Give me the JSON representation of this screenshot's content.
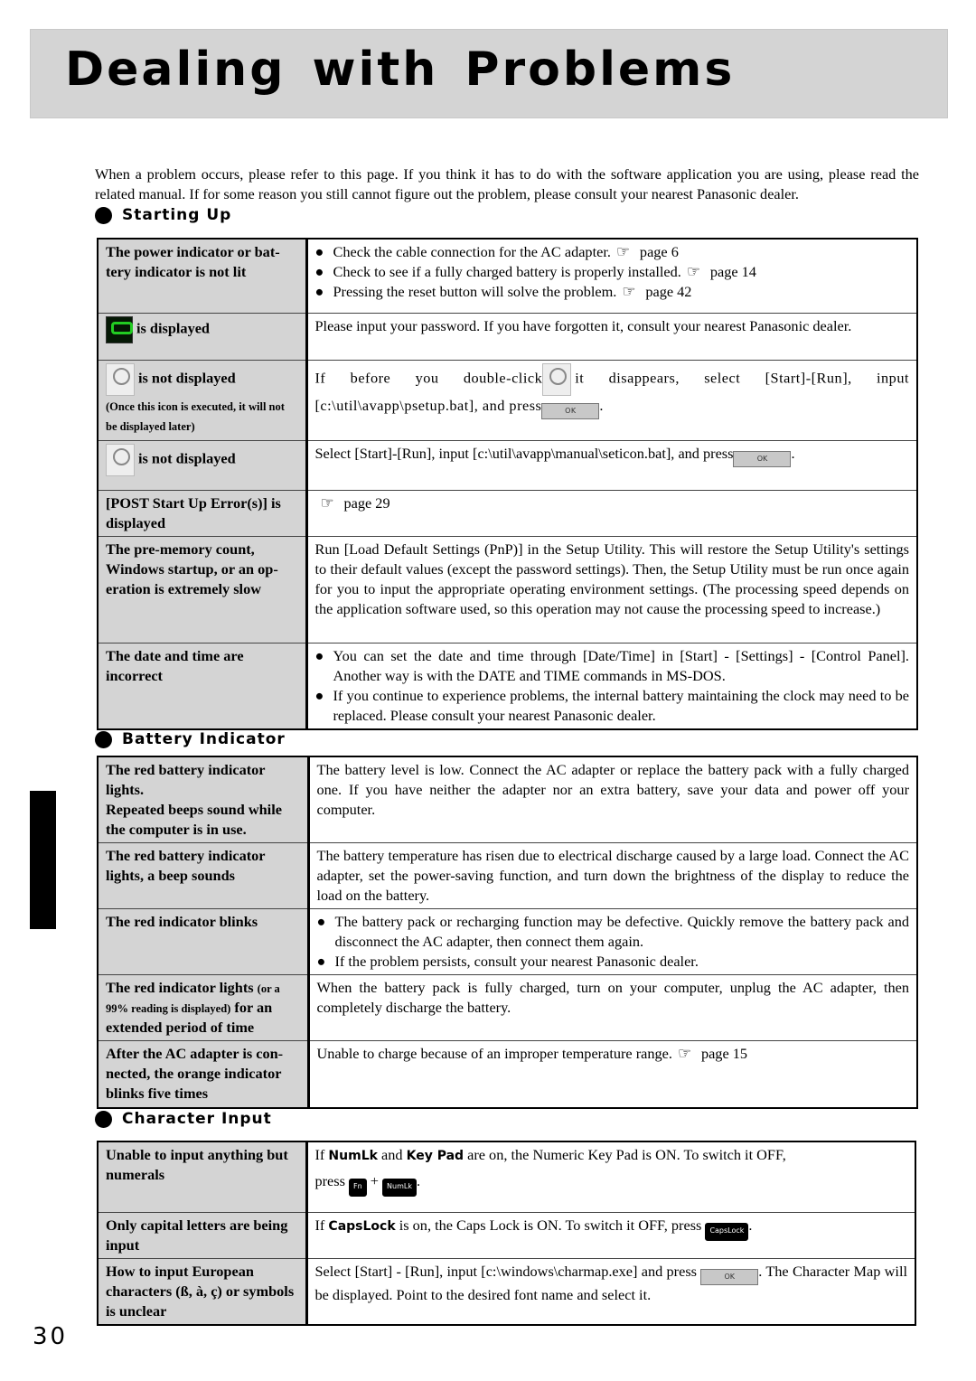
{
  "title": "Dealing with Problems",
  "intro": "When a problem occurs, please refer to this page.  If you think it has to do with the software application you are using, please read the related manual.  If for some reason you still cannot figure out the problem, please consult your nearest Panasonic dealer.",
  "page_number": "30",
  "sections": [
    {
      "heading": "Starting Up",
      "rows": [
        {
          "problem": [
            [
              {
                "t": "The power indicator or bat-tery indicator is not lit"
              }
            ]
          ],
          "solution": {
            "bullets": [
              [
                {
                  "t": "Check the cable connection for the AC adapter."
                },
                {
                  "icon": "pointer"
                },
                {
                  "t": "page 6"
                }
              ],
              [
                {
                  "t": "Check to see if a fully charged battery is properly installed."
                },
                {
                  "icon": "pointer"
                },
                {
                  "t": "page 14"
                }
              ],
              [
                {
                  "t": "Pressing the reset button will solve the problem."
                },
                {
                  "icon": "pointer"
                },
                {
                  "t": "page 42"
                }
              ]
            ]
          }
        },
        {
          "problem": [
            [
              {
                "icon": "password-key"
              },
              {
                "t": "is displayed"
              }
            ]
          ],
          "solution": {
            "paras": [
              [
                {
                  "t": "Please input your password.  If you have forgotten it, consult your nearest Panasonic dealer."
                }
              ]
            ]
          }
        },
        {
          "problem": [
            [
              {
                "icon": "panasonic-setup"
              },
              {
                "t": "is not displayed"
              }
            ],
            [
              {
                "t": "(Once this icon is executed,  it will not be displayed later)",
                "small": true
              }
            ]
          ],
          "solution": {
            "paras": [
              [
                {
                  "t": "If before you double-click"
                },
                {
                  "icon": "panasonic-setup"
                },
                {
                  "t": "it disappears, select [Start]-[Run], input [c:\\util\\avapp\\psetup.bat], and press"
                },
                {
                  "icon": "ok"
                },
                {
                  "t": "."
                }
              ]
            ],
            "spaced": true
          }
        },
        {
          "problem": [
            [
              {
                "icon": "quick-guide"
              },
              {
                "t": "is not displayed"
              }
            ]
          ],
          "solution": {
            "paras": [
              [
                {
                  "t": "Select [Start]-[Run], input [c:\\util\\avapp\\manual\\seticon.bat], and press"
                },
                {
                  "icon": "ok"
                },
                {
                  "t": "."
                }
              ]
            ]
          }
        },
        {
          "problem": [
            [
              {
                "t": "[POST Start Up Error(s)] is displayed"
              }
            ]
          ],
          "solution": {
            "paras": [
              [
                {
                  "icon": "pointer"
                },
                {
                  "t": "page 29"
                }
              ]
            ]
          }
        },
        {
          "problem": [
            [
              {
                "t": "The pre-memory count, Windows startup, or an op-eration is extremely slow"
              }
            ]
          ],
          "solution": {
            "paras": [
              [
                {
                  "t": "Run [Load Default Settings (PnP)] in the Setup Utility. This will restore the Setup Utility's settings to their default values (except the password settings). Then, the Setup Utility must be run once again for you to input the appropriate operating environment settings.  (The processing speed depends on the application software used, so this operation may not cause the processing speed to increase.)"
                }
              ]
            ]
          }
        },
        {
          "problem": [
            [
              {
                "t": "The date and time are incorrect"
              }
            ]
          ],
          "solution": {
            "bullets": [
              [
                {
                  "t": "You can set the date and time through [Date/Time] in [Start] - [Settings] - [Control Panel]. Another way is with the DATE and TIME commands in MS-DOS."
                }
              ],
              [
                {
                  "t": "If you continue to experience problems, the internal battery maintaining the clock may need to be replaced.  Please consult your nearest Panasonic dealer."
                }
              ]
            ]
          }
        }
      ]
    },
    {
      "heading": "Battery Indicator",
      "rows": [
        {
          "problem": [
            [
              {
                "t": "The red battery indicator lights."
              }
            ],
            [
              {
                "t": "Repeated beeps sound while the computer is in use."
              }
            ]
          ],
          "solution": {
            "paras": [
              [
                {
                  "t": "The battery level is low. Connect the AC adapter or replace the battery pack with a fully charged one. If you have neither the adapter nor an extra battery, save your data and power off your computer."
                }
              ]
            ]
          }
        },
        {
          "problem": [
            [
              {
                "t": "The red battery indicator lights, a beep sounds"
              }
            ]
          ],
          "solution": {
            "paras": [
              [
                {
                  "t": "The battery temperature has risen due to electrical discharge caused by a large load. Connect the AC adapter, set the power-saving function, and turn down the brightness of the display to reduce the load on the battery."
                }
              ]
            ]
          }
        },
        {
          "problem": [
            [
              {
                "t": "The red indicator blinks"
              }
            ]
          ],
          "solution": {
            "bullets": [
              [
                {
                  "t": "The battery pack or recharging function may be defective.  Quickly remove the battery pack and disconnect the AC adapter, then connect them again."
                }
              ],
              [
                {
                  "t": "If the problem persists, consult your nearest Panasonic dealer."
                }
              ]
            ]
          }
        },
        {
          "problem": [
            [
              {
                "t": "The red indicator lights "
              },
              {
                "t": "(or a 99% reading is displayed)",
                "small": true
              },
              {
                "t": " for an extended period of time"
              }
            ]
          ],
          "solution": {
            "paras": [
              [
                {
                  "t": "When the battery pack is fully charged, turn on your computer, unplug the AC adapter, then completely discharge the battery."
                }
              ]
            ]
          }
        },
        {
          "problem": [
            [
              {
                "t": "After the AC adapter is con-nected, the orange indicator blinks five times"
              }
            ]
          ],
          "solution": {
            "paras": [
              [
                {
                  "t": "Unable to charge because of an improper temperature range."
                },
                {
                  "icon": "pointer"
                },
                {
                  "t": "page 15"
                }
              ]
            ]
          }
        }
      ]
    },
    {
      "heading": "Character Input",
      "rows": [
        {
          "problem": [
            [
              {
                "t": "Unable to input anything but numerals"
              }
            ]
          ],
          "solution": {
            "paras": [
              [
                {
                  "t": "If "
                },
                {
                  "t": "NumLk",
                  "sans": true
                },
                {
                  "t": " and "
                },
                {
                  "t": "Key Pad",
                  "sans": true
                },
                {
                  "t": " are on, the Numeric Key Pad is ON.  To switch it OFF,"
                }
              ],
              [
                {
                  "t": "press "
                },
                {
                  "key": "Fn"
                },
                {
                  "t": " + "
                },
                {
                  "key": "NumLk"
                },
                {
                  "t": "."
                }
              ]
            ]
          }
        },
        {
          "problem": [
            [
              {
                "t": "Only capital letters are being input"
              }
            ]
          ],
          "solution": {
            "paras": [
              [
                {
                  "t": "If "
                },
                {
                  "t": "CapsLock",
                  "sans": true
                },
                {
                  "t": " is on, the Caps Lock is ON.  To switch it OFF, press "
                },
                {
                  "key": "CapsLock"
                },
                {
                  "t": "."
                }
              ]
            ]
          }
        },
        {
          "problem": [
            [
              {
                "t": "How to input European characters (ß, à, ç) or symbols is unclear"
              }
            ]
          ],
          "solution": {
            "paras": [
              [
                {
                  "t": "Select [Start] - [Run],  input [c:\\windows\\charmap.exe] and press "
                },
                {
                  "icon": "ok"
                },
                {
                  "t": ". The Character Map will be displayed.  Point to the desired font name and select it."
                }
              ]
            ]
          }
        }
      ]
    }
  ],
  "ok_label": "OK"
}
